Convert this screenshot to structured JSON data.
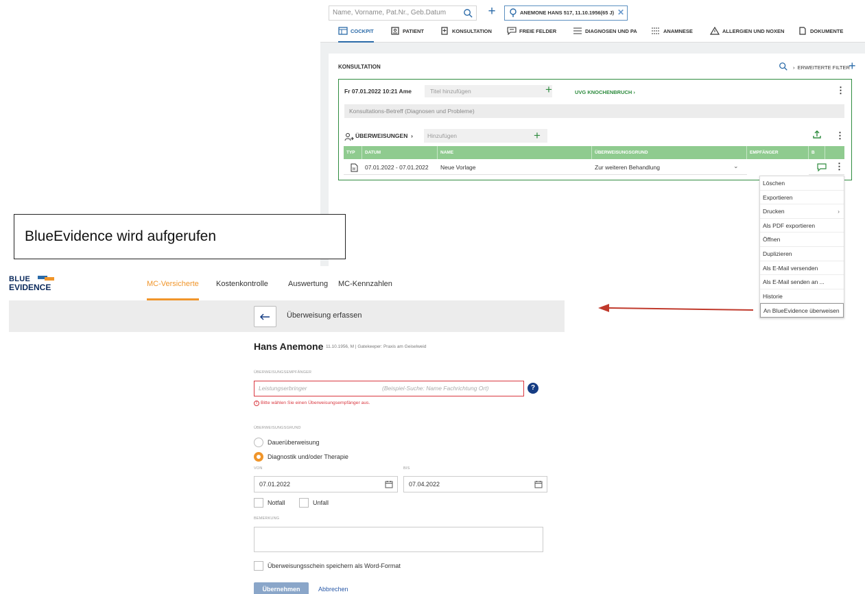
{
  "top_app": {
    "search_placeholder": "Name, Vorname, Pat.Nr., Geb.Datum",
    "patient_tab": "ANEMONE HANS 517, 11.10.1956(65 J)",
    "nav": [
      {
        "label": "COCKPIT",
        "icon": "cockpit-icon"
      },
      {
        "label": "PATIENT",
        "icon": "patient-card-icon"
      },
      {
        "label": "KONSULTATION",
        "icon": "consultation-icon"
      },
      {
        "label": "FREIE FELDER",
        "icon": "comment-icon"
      },
      {
        "label": "DIAGNOSEN UND PA",
        "icon": "list-icon"
      },
      {
        "label": "ANAMNESE",
        "icon": "list-icon"
      },
      {
        "label": "ALLERGIEN UND NOXEN",
        "icon": "warning-icon"
      },
      {
        "label": "DOKUMENTE",
        "icon": "document-icon"
      }
    ],
    "panel_title": "KONSULTATION",
    "filter_label": "ERWEITERTE FILTER",
    "consultation": {
      "date": "Fr 07.01.2022  10:21  Ame",
      "title_placeholder": "Titel hinzufügen",
      "diagnosis_link": "UVG KNOCHENBRUCH",
      "betreff_placeholder": "Konsultations-Betreff (Diagnosen und Probleme)"
    },
    "referrals": {
      "label": "ÜBERWEISUNGEN",
      "add_placeholder": "Hinzufügen",
      "columns": [
        "TYP",
        "DATUM",
        "NAME",
        "ÜBERWEISUNGSGRUND",
        "EMPFÄNGER",
        "B"
      ],
      "rows": [
        {
          "datum": "07.01.2022 - 07.01.2022",
          "name": "Neue Vorlage",
          "grund": "Zur weiteren Behandlung",
          "empfaenger": ""
        }
      ]
    }
  },
  "context_menu": [
    {
      "label": "Löschen"
    },
    {
      "label": "Exportieren"
    },
    {
      "label": "Drucken"
    },
    {
      "label": "Als PDF exportieren"
    },
    {
      "label": "Öffnen"
    },
    {
      "label": "Duplizieren"
    },
    {
      "label": "Als E-Mail versenden"
    },
    {
      "label": "Als E-Mail senden an ..."
    },
    {
      "label": "Historie"
    },
    {
      "label": "An BlueEvidence überweisen"
    }
  ],
  "callout": "BlueEvidence wird aufgerufen",
  "blue_evidence": {
    "logo_line1": "BLUE",
    "logo_line2": "EVIDENCE",
    "nav": [
      "MC-Versicherte",
      "Kostenkontrolle",
      "Auswertung",
      "MC-Kennzahlen"
    ],
    "bar_title": "Überweisung erfassen",
    "patient_name": "Hans Anemone",
    "patient_info": "11.10.1956, M | Gatekeeper: Praxis am Geiselweid",
    "recipient_label": "ÜBERWEISUNGSEMPFÄNGER",
    "recipient_placeholder": "Leistungserbringer",
    "recipient_hint": "(Beispiel-Suche: Name Fachrichtung Ort)",
    "recipient_error": "Bitte wählen Sie einen Überweisungsempfänger aus.",
    "reason_label": "ÜBERWEISUNGSGRUND",
    "reason_options": [
      "Dauerüberweisung",
      "Diagnostik und/oder Therapie"
    ],
    "von_label": "VON",
    "von_value": "07.01.2022",
    "bis_label": "BIS",
    "bis_value": "07.04.2022",
    "notfall_label": "Notfall",
    "unfall_label": "Unfall",
    "bemerkung_label": "BEMERKUNG",
    "word_label": "Überweisungsschein speichern als Word-Format",
    "submit_label": "Übernehmen",
    "cancel_label": "Abbrechen"
  },
  "colors": {
    "accent_blue": "#2a6aa8",
    "green": "#2e8b3e",
    "table_header": "#8fcb8f",
    "orange": "#f0952a",
    "error_red": "#d9373f",
    "arrow_red": "#c0392b",
    "navy": "#153c83"
  }
}
